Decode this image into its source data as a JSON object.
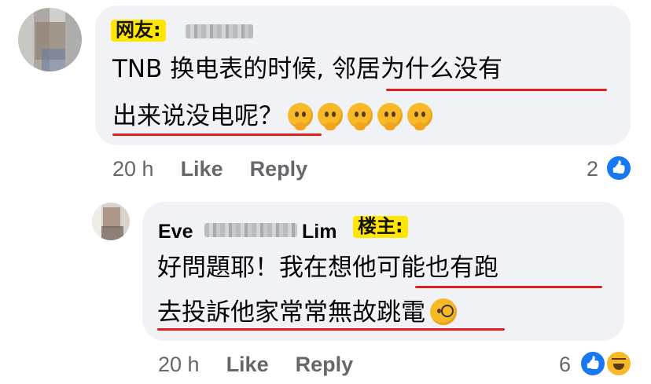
{
  "comment": {
    "tag": "网友:",
    "text_before_underline": "TNB 换电表的时候, ",
    "text_underlined_line1": "邻居为什么没有",
    "text_underlined_line2": "出来说没电呢？",
    "emoji_name": "thinking-face-icon",
    "emoji_count": 5,
    "time": "20 h",
    "like_label": "Like",
    "reply_label": "Reply",
    "reaction_count": "2",
    "reactions": [
      "like-icon"
    ]
  },
  "reply": {
    "author_first": "Eve",
    "author_last": "Lim",
    "tag": "楼主:",
    "text_line1_plain": "好問題耶！我在想",
    "text_line1_underlined": "他可能也有跑",
    "text_line2_underlined": "去投訴他家常常無故跳電",
    "emoji_name": "face-with-monocle-icon",
    "time": "20 h",
    "like_label": "Like",
    "reply_label": "Reply",
    "reaction_count": "6",
    "reactions": [
      "like-icon",
      "haha-icon"
    ]
  },
  "colors": {
    "bubble": "#f0f2f5",
    "underline": "#e0201c",
    "tag_bg": "#ffe600",
    "meta_text": "#65676b",
    "like_blue": "#1877f2"
  }
}
